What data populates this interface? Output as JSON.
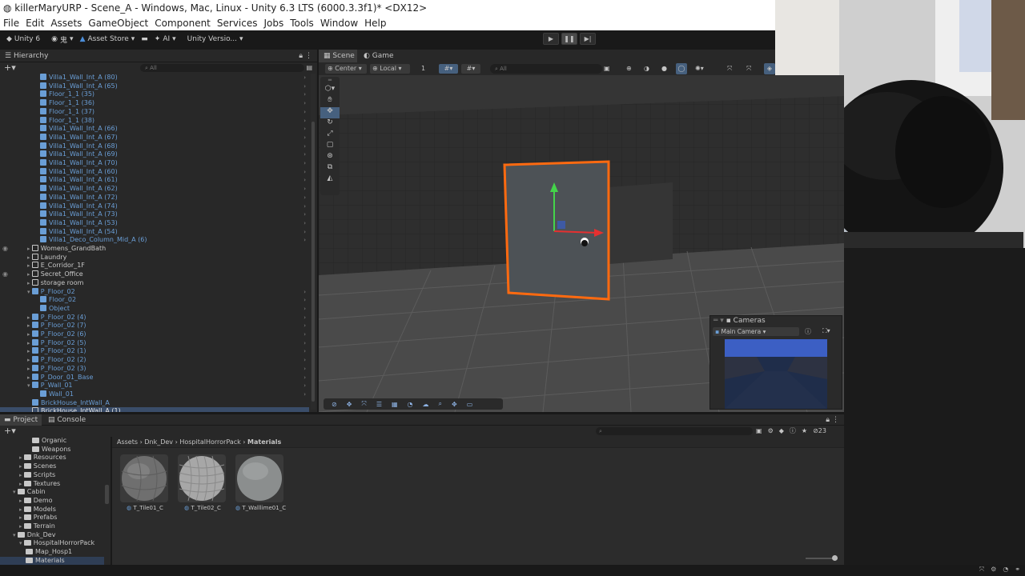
{
  "window": {
    "title": "killerMaryURP - Scene_A - Windows, Mac, Linux - Unity 6.3 LTS (6000.3.3f1)* <DX12>"
  },
  "menu": [
    "File",
    "Edit",
    "Assets",
    "GameObject",
    "Component",
    "Services",
    "Jobs",
    "Tools",
    "Window",
    "Help"
  ],
  "toolbar": {
    "unity_label": "Unity 6",
    "account_label": "鬼",
    "asset_store_label": "Asset Store",
    "ai_label": "AI",
    "version_control_label": "Unity Versio..."
  },
  "hierarchy": {
    "tab_label": "Hierarchy",
    "search_placeholder": "All",
    "items": [
      {
        "label": "Villa1_Wall_Int_A (80)",
        "indent": 2,
        "color": "blue"
      },
      {
        "label": "Villa1_Wall_Int_A (65)",
        "indent": 2,
        "color": "blue"
      },
      {
        "label": "Floor_1_1 (35)",
        "indent": 2,
        "color": "blue"
      },
      {
        "label": "Floor_1_1 (36)",
        "indent": 2,
        "color": "blue"
      },
      {
        "label": "Floor_1_1 (37)",
        "indent": 2,
        "color": "blue"
      },
      {
        "label": "Floor_1_1 (38)",
        "indent": 2,
        "color": "blue"
      },
      {
        "label": "Villa1_Wall_Int_A (66)",
        "indent": 2,
        "color": "blue"
      },
      {
        "label": "Villa1_Wall_Int_A (67)",
        "indent": 2,
        "color": "blue"
      },
      {
        "label": "Villa1_Wall_Int_A (68)",
        "indent": 2,
        "color": "blue"
      },
      {
        "label": "Villa1_Wall_Int_A (69)",
        "indent": 2,
        "color": "blue"
      },
      {
        "label": "Villa1_Wall_Int_A (70)",
        "indent": 2,
        "color": "blue"
      },
      {
        "label": "Villa1_Wall_Int_A (60)",
        "indent": 2,
        "color": "blue"
      },
      {
        "label": "Villa1_Wall_Int_A (61)",
        "indent": 2,
        "color": "blue"
      },
      {
        "label": "Villa1_Wall_Int_A (62)",
        "indent": 2,
        "color": "blue"
      },
      {
        "label": "Villa1_Wall_Int_A (72)",
        "indent": 2,
        "color": "blue"
      },
      {
        "label": "Villa1_Wall_Int_A (74)",
        "indent": 2,
        "color": "blue"
      },
      {
        "label": "Villa1_Wall_Int_A (73)",
        "indent": 2,
        "color": "blue"
      },
      {
        "label": "Villa1_Wall_Int_A (53)",
        "indent": 2,
        "color": "blue"
      },
      {
        "label": "Villa1_Wall_Int_A (54)",
        "indent": 2,
        "color": "blue"
      },
      {
        "label": "Villa1_Deco_Column_Mid_A (6)",
        "indent": 2,
        "color": "blue"
      },
      {
        "label": "Womens_GrandBath",
        "indent": 1,
        "color": "white"
      },
      {
        "label": "Laundry",
        "indent": 1,
        "color": "white"
      },
      {
        "label": "E_Corridor_1F",
        "indent": 1,
        "color": "white"
      },
      {
        "label": "Secret_Office",
        "indent": 1,
        "color": "white"
      },
      {
        "label": "storage room",
        "indent": 1,
        "color": "white"
      },
      {
        "label": "P_Floor_02",
        "indent": 1,
        "color": "blue"
      },
      {
        "label": "Floor_02",
        "indent": 2,
        "color": "blue"
      },
      {
        "label": "Object",
        "indent": 2,
        "color": "blue"
      },
      {
        "label": "P_Floor_02 (4)",
        "indent": 1,
        "color": "blue"
      },
      {
        "label": "P_Floor_02 (7)",
        "indent": 1,
        "color": "blue"
      },
      {
        "label": "P_Floor_02 (6)",
        "indent": 1,
        "color": "blue"
      },
      {
        "label": "P_Floor_02 (5)",
        "indent": 1,
        "color": "blue"
      },
      {
        "label": "P_Floor_02 (1)",
        "indent": 1,
        "color": "blue"
      },
      {
        "label": "P_Floor_02 (2)",
        "indent": 1,
        "color": "blue"
      },
      {
        "label": "P_Floor_02 (3)",
        "indent": 1,
        "color": "blue"
      },
      {
        "label": "P_Door_01_Base",
        "indent": 1,
        "color": "blue"
      },
      {
        "label": "P_Wall_01",
        "indent": 1,
        "color": "blue"
      },
      {
        "label": "Wall_01",
        "indent": 2,
        "color": "blue"
      },
      {
        "label": "BrickHouse_IntWall_A",
        "indent": 0,
        "color": "blue"
      },
      {
        "label": "BrickHouse_IntWall_A (1)",
        "indent": 0,
        "color": "white"
      }
    ]
  },
  "scene": {
    "tab_scene": "Scene",
    "tab_game": "Game",
    "pivot_label": "Center",
    "space_label": "Local",
    "snap_value": "1",
    "search_placeholder": "All"
  },
  "cameras": {
    "title": "Cameras",
    "selected": "Main Camera"
  },
  "project": {
    "tab_project": "Project",
    "tab_console": "Console",
    "breadcrumb": [
      "Assets",
      "Dnk_Dev",
      "HospitalHorrorPack",
      "Materials"
    ],
    "count": "23",
    "tree": [
      {
        "label": "Organic",
        "indent": 4
      },
      {
        "label": "Weapons",
        "indent": 4
      },
      {
        "label": "Resources",
        "indent": 2
      },
      {
        "label": "Scenes",
        "indent": 2
      },
      {
        "label": "Scripts",
        "indent": 2
      },
      {
        "label": "Textures",
        "indent": 2
      },
      {
        "label": "Cabin",
        "indent": 1
      },
      {
        "label": "Demo",
        "indent": 2
      },
      {
        "label": "Models",
        "indent": 2
      },
      {
        "label": "Prefabs",
        "indent": 2
      },
      {
        "label": "Terrain",
        "indent": 2
      },
      {
        "label": "Dnk_Dev",
        "indent": 1
      },
      {
        "label": "HospitalHorrorPack",
        "indent": 2
      },
      {
        "label": "Map_Hosp1",
        "indent": 3
      },
      {
        "label": "Materials",
        "indent": 3
      }
    ],
    "assets": [
      "T_Tile01_C",
      "T_Tile02_C",
      "T_Walllime01_C"
    ]
  }
}
